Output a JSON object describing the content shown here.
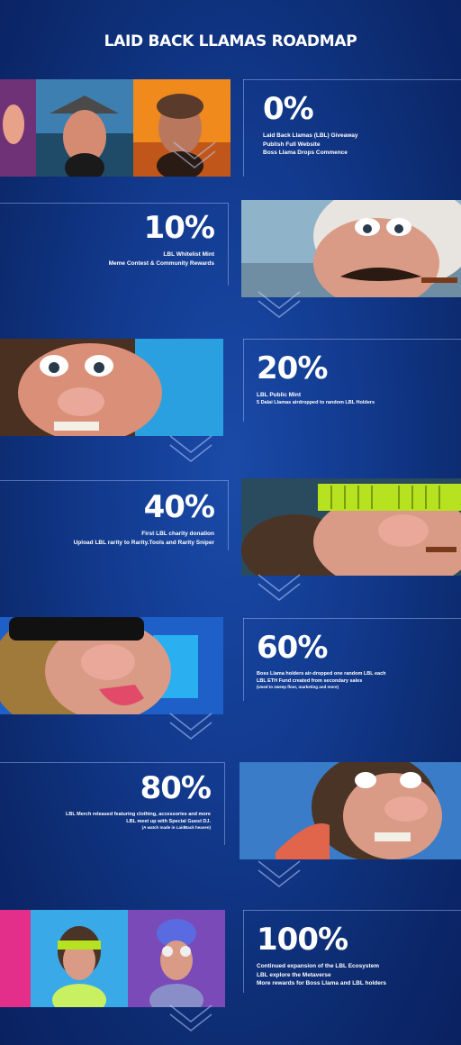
{
  "title": "LAID BACK LLAMAS ROADMAP",
  "milestones": [
    {
      "percent": "0%",
      "lines": [
        "Laid Back Llamas (LBL) Giveaway",
        "Publish Full Website",
        "Boss Llama Drops Commence"
      ]
    },
    {
      "percent": "10%",
      "lines": [
        "LBL Whitelist Mint",
        "Meme Contest & Community Rewards"
      ]
    },
    {
      "percent": "20%",
      "lines": [
        "LBL Public Mint",
        "5 Dalai Llamas airdropped to random LBL Holders"
      ]
    },
    {
      "percent": "40%",
      "lines": [
        "First LBL charity donation",
        "Upload LBL rarity to Rarity.Tools and Rarity Sniper"
      ]
    },
    {
      "percent": "60%",
      "lines": [
        "Boss Llama holders air-dropped one random LBL each",
        "LBL ETH Fund created from secondary sales"
      ],
      "note": "(Used to sweep floor, marketing and more)"
    },
    {
      "percent": "80%",
      "lines": [
        "LBL Merch released featuring clothing, accessories and more",
        "LBL meet up with Special Guest DJ."
      ],
      "note": "(A watch made in LaidBack heaven)"
    },
    {
      "percent": "100%",
      "lines": [
        "Continued expansion of the LBL Ecosystem",
        "LBL explore the Metaverse",
        "More rewards for Boss Llama and LBL holders"
      ]
    }
  ],
  "colors": {
    "background": "#123a8e",
    "accent": "#ffffff"
  }
}
